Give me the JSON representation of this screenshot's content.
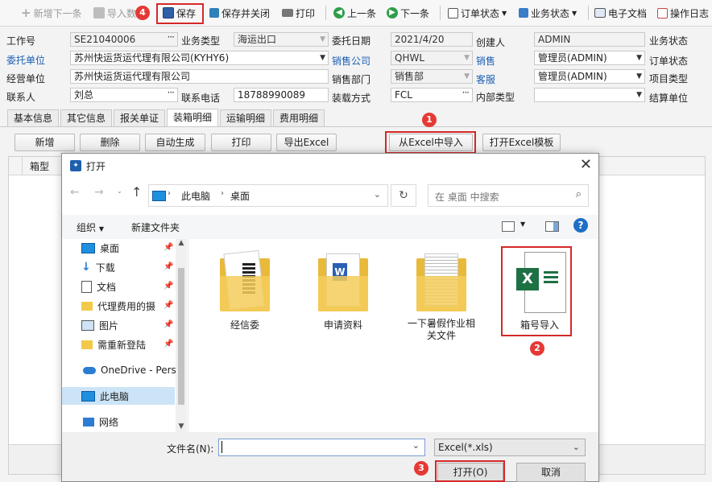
{
  "toolbar": {
    "add_next": "新增下一条",
    "import": "导入数",
    "save": "保存",
    "save_close": "保存并关闭",
    "print": "打印",
    "prev": "上一条",
    "next": "下一条",
    "order_status": "订单状态",
    "biz_status": "业务状态",
    "e_docs": "电子文档",
    "op_log": "操作日志"
  },
  "badges": [
    "1",
    "2",
    "3",
    "4"
  ],
  "form": {
    "job_no_label": "工作号",
    "job_no": "SE21040006",
    "biz_type_label": "业务类型",
    "biz_type": "海运出口",
    "entrust_date_label": "委托日期",
    "entrust_date": "2021/4/20",
    "creator_label": "创建人",
    "creator": "ADMIN",
    "biz_state_label": "业务状态",
    "client_label": "委托单位",
    "client": "苏州快运货运代理有限公司(KYHY6)",
    "sales_company_label": "销售公司",
    "sales_company": "QHWL",
    "sales_label": "销售",
    "sales": "管理员(ADMIN)",
    "order_state_label": "订单状态",
    "operator_unit_label": "经营单位",
    "operator_unit": "苏州快运货运代理有限公司",
    "sales_dept_label": "销售部门",
    "sales_dept": "销售部",
    "cs_label": "客服",
    "cs": "管理员(ADMIN)",
    "project_type_label": "项目类型",
    "contact_label": "联系人",
    "contact": "刘总",
    "phone_label": "联系电话",
    "phone": "18788990089",
    "load_mode_label": "装载方式",
    "load_mode": "FCL",
    "internal_type_label": "内部类型",
    "internal_type": "",
    "settle_type_label": "结算单位"
  },
  "tabs": [
    "基本信息",
    "其它信息",
    "报关单证",
    "装箱明细",
    "运输明细",
    "费用明细"
  ],
  "actions": {
    "add": "新增",
    "delete": "删除",
    "auto_gen": "自动生成",
    "print": "打印",
    "export_excel": "导出Excel",
    "import_excel": "从Excel中导入",
    "open_template": "打开Excel模板"
  },
  "grid": {
    "col_box": "箱型"
  },
  "dialog": {
    "title": "打开",
    "path": [
      "此电脑",
      "桌面"
    ],
    "search_placeholder": "在 桌面 中搜索",
    "organize": "组织",
    "new_folder": "新建文件夹",
    "sidebar": [
      "桌面",
      "下载",
      "文档",
      "代理费用的摄",
      "图片",
      "需重新登陆",
      "OneDrive - Perso",
      "此电脑",
      "网络"
    ],
    "files": [
      {
        "name": "经信委",
        "kind": "folder"
      },
      {
        "name": "申请资料",
        "kind": "folder"
      },
      {
        "name": "一下暑假作业相关文件",
        "kind": "folder"
      },
      {
        "name": "箱号导入",
        "kind": "excel"
      }
    ],
    "filename_label": "文件名(N):",
    "filename_value": "",
    "filetype": "Excel(*.xls)",
    "open_btn": "打开(O)",
    "cancel_btn": "取消"
  },
  "colors": {
    "highlight": "#d62828",
    "link": "#1a5fb4",
    "excel_green": "#1e7145"
  }
}
